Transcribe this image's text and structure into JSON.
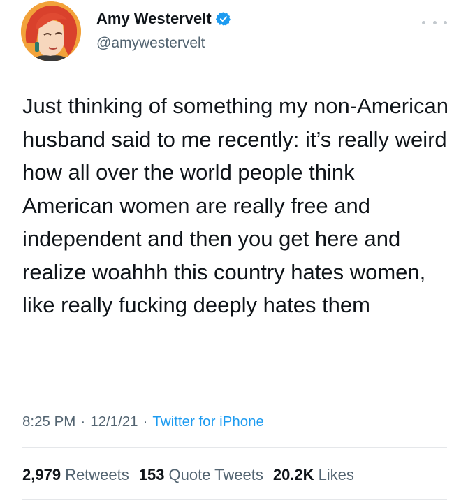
{
  "tweet": {
    "author": {
      "display_name": "Amy Westervelt",
      "handle": "@amywestervelt",
      "verified": true
    },
    "text": "Just thinking of something my non-American husband said to me recently: it’s really weird how all over the world people think American women are really free and independent and then you get here and realize woahhh this country hates women, like really fucking deeply hates them",
    "time": "8:25 PM",
    "date": "12/1/21",
    "source": "Twitter for iPhone",
    "stats": {
      "retweets_count": "2,979",
      "retweets_label": "Retweets",
      "quotes_count": "153",
      "quotes_label": "Quote Tweets",
      "likes_count": "20.2K",
      "likes_label": "Likes"
    }
  },
  "colors": {
    "text_primary": "#0f1419",
    "text_secondary": "#536471",
    "link": "#1d9bf0",
    "verified_badge": "#1d9bf0",
    "avatar_background": "#f2a23a"
  },
  "icons": {
    "verified": "verified-badge-icon",
    "more": "more-options-icon"
  }
}
